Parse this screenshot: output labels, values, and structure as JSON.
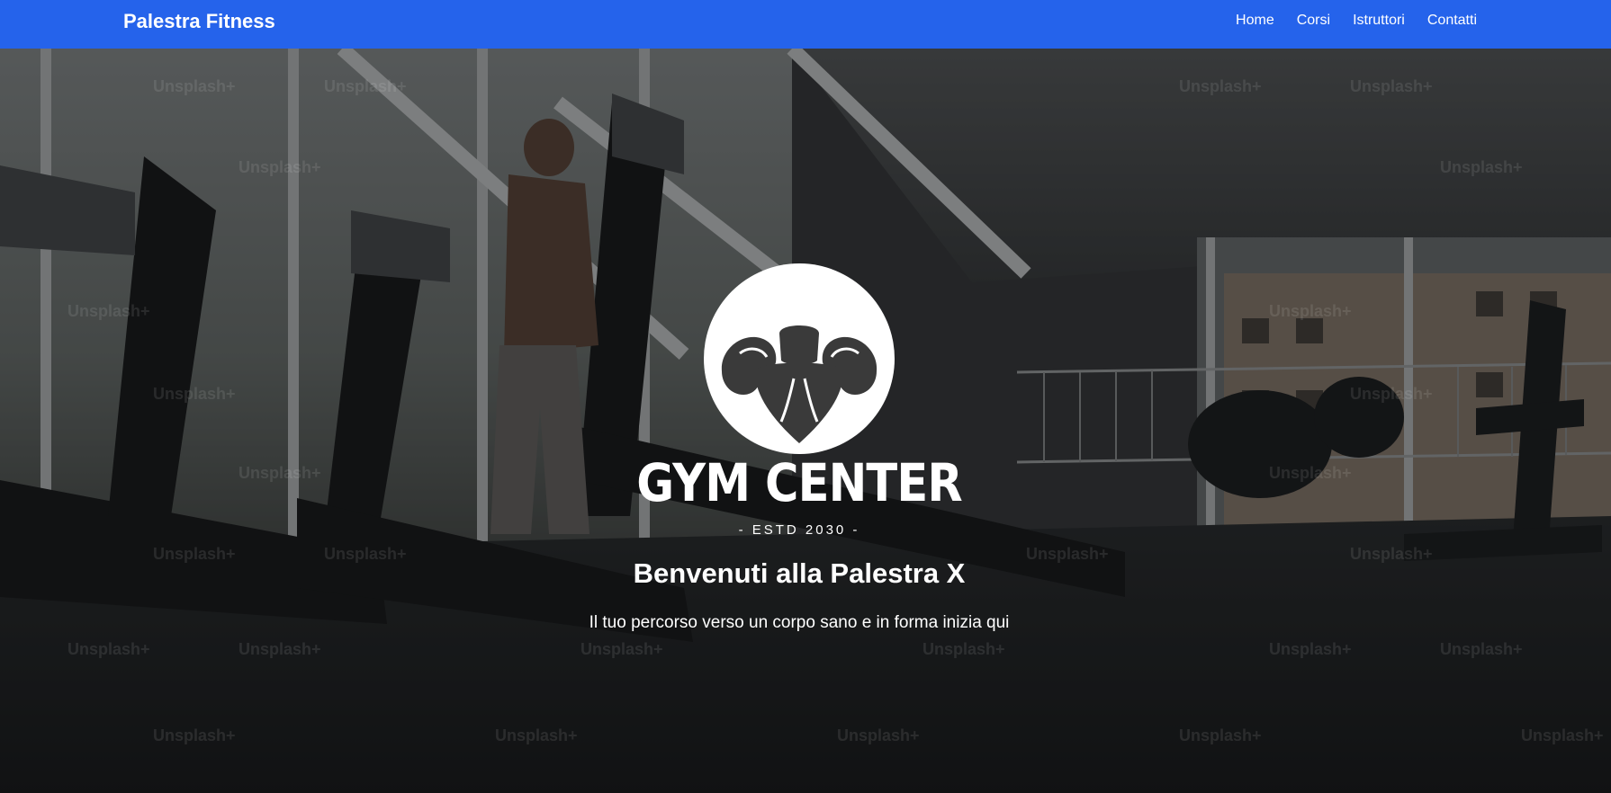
{
  "navbar": {
    "brand": "Palestra Fitness",
    "links": [
      {
        "label": "Home"
      },
      {
        "label": "Corsi"
      },
      {
        "label": "Istruttori"
      },
      {
        "label": "Contatti"
      }
    ],
    "background_color": "#2563eb"
  },
  "hero": {
    "logo_title": "GYM CENTER",
    "logo_subtitle": "- ESTD 2030 -",
    "heading": "Benvenuti alla Palestra X",
    "subheading": "Il tuo percorso verso un corpo sano e in forma inizia qui",
    "background_image_watermark": "Unsplash+",
    "logo_icon": "flexing-arms-icon"
  }
}
